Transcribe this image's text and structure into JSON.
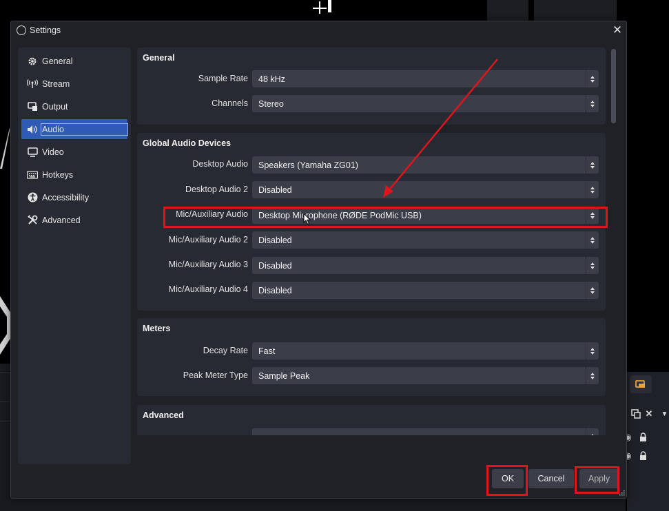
{
  "dialog": {
    "title": "Settings"
  },
  "sidebar": {
    "items": [
      {
        "label": "General",
        "icon": "gear-icon"
      },
      {
        "label": "Stream",
        "icon": "broadcast-icon"
      },
      {
        "label": "Output",
        "icon": "output-icon"
      },
      {
        "label": "Audio",
        "icon": "speaker-icon",
        "active": true
      },
      {
        "label": "Video",
        "icon": "monitor-icon"
      },
      {
        "label": "Hotkeys",
        "icon": "keyboard-icon"
      },
      {
        "label": "Accessibility",
        "icon": "accessibility-icon"
      },
      {
        "label": "Advanced",
        "icon": "tools-icon"
      }
    ]
  },
  "general": {
    "title": "General",
    "sample_rate": {
      "label": "Sample Rate",
      "value": "48 kHz"
    },
    "channels": {
      "label": "Channels",
      "value": "Stereo"
    }
  },
  "devices": {
    "title": "Global Audio Devices",
    "desktop_audio": {
      "label": "Desktop Audio",
      "value": "Speakers (Yamaha ZG01)"
    },
    "desktop_audio_2": {
      "label": "Desktop Audio 2",
      "value": "Disabled"
    },
    "mic_aux": {
      "label": "Mic/Auxiliary Audio",
      "value": "Desktop Microphone (RØDE PodMic USB)"
    },
    "mic_aux_2": {
      "label": "Mic/Auxiliary Audio 2",
      "value": "Disabled"
    },
    "mic_aux_3": {
      "label": "Mic/Auxiliary Audio 3",
      "value": "Disabled"
    },
    "mic_aux_4": {
      "label": "Mic/Auxiliary Audio 4",
      "value": "Disabled"
    }
  },
  "meters": {
    "title": "Meters",
    "decay_rate": {
      "label": "Decay Rate",
      "value": "Fast"
    },
    "peak_meter_type": {
      "label": "Peak Meter Type",
      "value": "Sample Peak"
    }
  },
  "advanced": {
    "title": "Advanced"
  },
  "buttons": {
    "ok": "OK",
    "cancel": "Cancel",
    "apply": "Apply"
  },
  "colors": {
    "accent": "#2f5bb7",
    "highlight": "#e0141c",
    "panel": "#272a33",
    "dialog": "#1f2127"
  }
}
